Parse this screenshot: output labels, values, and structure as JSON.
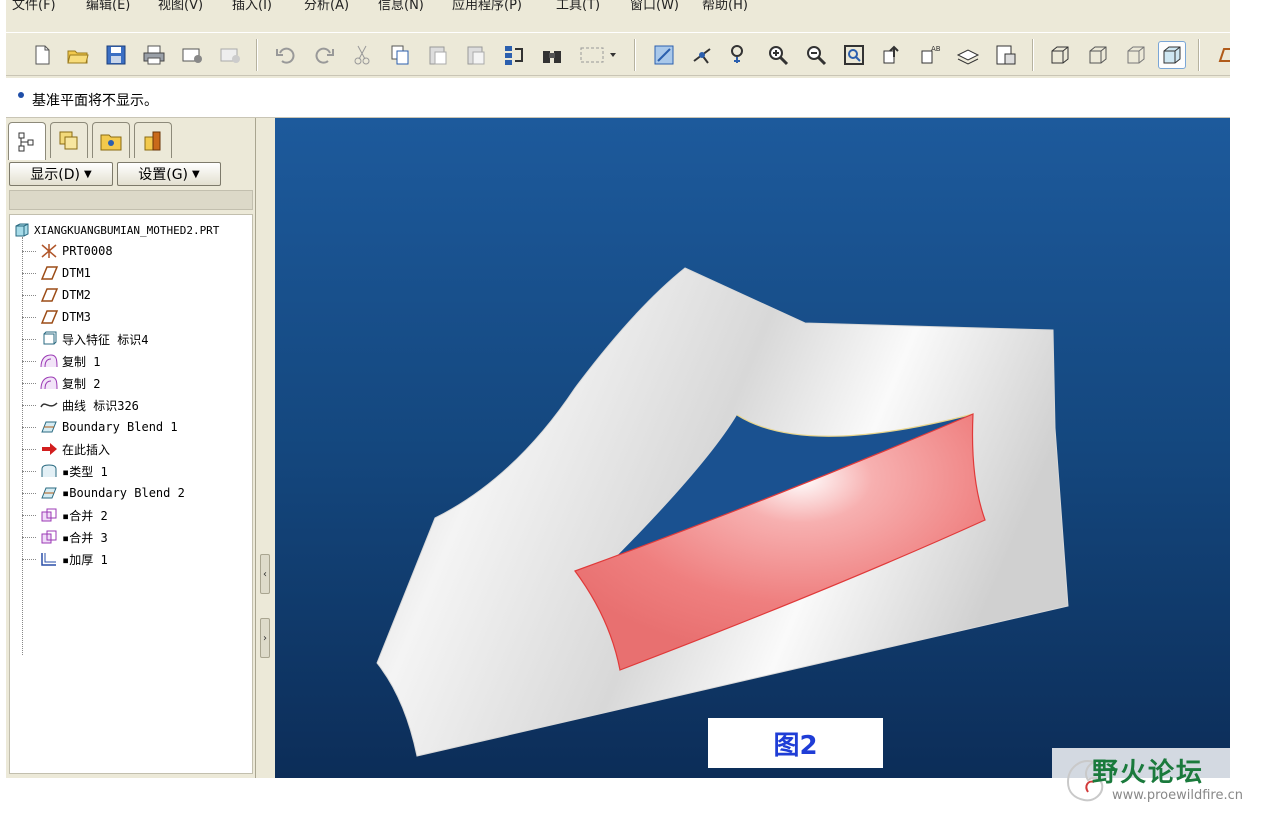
{
  "menu": [
    "文件(F)",
    "编辑(E)",
    "视图(V)",
    "插入(I)",
    "分析(A)",
    "信息(N)",
    "应用程序(P)",
    "工具(T)",
    "窗口(W)",
    "帮助(H)"
  ],
  "message": "基准平面将不显示。",
  "panel": {
    "display_button": "显示(D)",
    "settings_button": "设置(G)"
  },
  "tree": {
    "root": "XIANGKUANGBUMIAN_MOTHED2.PRT",
    "items": [
      {
        "label": "PRT0008",
        "icon": "csys-icon"
      },
      {
        "label": "DTM1",
        "icon": "datum-plane-icon"
      },
      {
        "label": "DTM2",
        "icon": "datum-plane-icon"
      },
      {
        "label": "DTM3",
        "icon": "datum-plane-icon"
      },
      {
        "label": "导入特征 标识4",
        "icon": "import-feature-icon"
      },
      {
        "label": "复制 1",
        "icon": "copy-surface-icon"
      },
      {
        "label": "复制 2",
        "icon": "copy-surface-icon"
      },
      {
        "label": "曲线 标识326",
        "icon": "curve-icon"
      },
      {
        "label": "Boundary Blend 1",
        "icon": "boundary-blend-icon"
      },
      {
        "label": "在此插入",
        "icon": "insert-here-arrow-icon"
      },
      {
        "label": "▪类型 1",
        "icon": "surface-type-icon"
      },
      {
        "label": "▪Boundary Blend 2",
        "icon": "boundary-blend-icon"
      },
      {
        "label": "▪合并 2",
        "icon": "merge-icon"
      },
      {
        "label": "▪合并 3",
        "icon": "merge-icon"
      },
      {
        "label": "▪加厚 1",
        "icon": "thicken-icon"
      }
    ]
  },
  "graphics": {
    "caption": "图2",
    "background_color": "#14477e",
    "highlight_color": "#f08080"
  },
  "watermark": {
    "title": "野火论坛",
    "url": "www.proewildfire.cn"
  }
}
